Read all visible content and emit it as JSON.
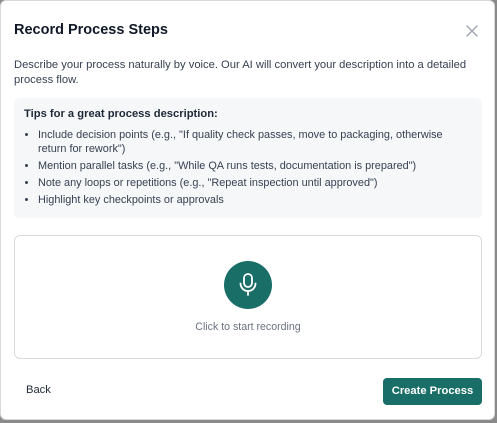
{
  "dialog": {
    "title": "Record Process Steps",
    "description": "Describe your process naturally by voice. Our AI will convert your description into a detailed process flow."
  },
  "tips": {
    "heading": "Tips for a great process description:",
    "items": [
      "Include decision points (e.g., \"If quality check passes, move to packaging, otherwise return for rework\")",
      "Mention parallel tasks (e.g., \"While QA runs tests, documentation is prepared\")",
      "Note any loops or repetitions (e.g., \"Repeat inspection until approved\")",
      "Highlight key checkpoints or approvals"
    ]
  },
  "recorder": {
    "icon": "microphone-icon",
    "label": "Click to start recording"
  },
  "footer": {
    "back_label": "Back",
    "create_label": "Create Process"
  },
  "colors": {
    "accent": "#1a6e68",
    "tips_background": "#f5f7f9",
    "overlay": "#8a8a8a"
  }
}
